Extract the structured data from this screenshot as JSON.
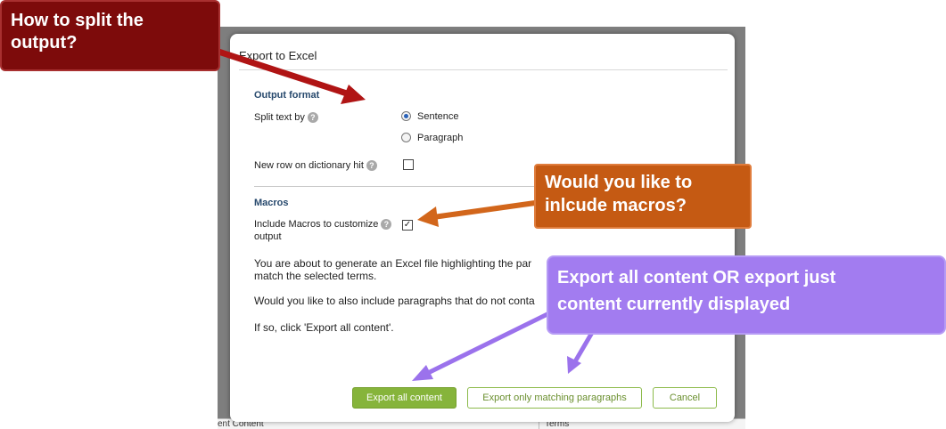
{
  "background": {
    "col1_text": "ent Content",
    "col2_text": "Terms"
  },
  "dialog": {
    "title": "Export to Excel",
    "output_format": {
      "heading": "Output format",
      "split_label": "Split text by",
      "options": [
        {
          "label": "Sentence",
          "selected": true
        },
        {
          "label": "Paragraph",
          "selected": false
        }
      ],
      "new_row_label": "New row on dictionary hit",
      "new_row_checked": false
    },
    "macros": {
      "heading": "Macros",
      "include_label_line1": "Include Macros to customize",
      "include_label_line2": "output",
      "include_checked": true
    },
    "message": {
      "line1": "You are about to generate an Excel file highlighting the par",
      "line2": "match the selected terms.",
      "line3": "Would you like to also include paragraphs that do not conta",
      "line4": "If so, click 'Export all content'."
    },
    "buttons": {
      "export_all": "Export all content",
      "export_matching": "Export only matching paragraphs",
      "cancel": "Cancel"
    }
  },
  "callouts": {
    "split": {
      "line1": "How to split the",
      "line2": "output?",
      "color": "#7d0b0b"
    },
    "macros": {
      "line1": "Would you like to",
      "line2": "inlcude macros?",
      "color": "#c55a13"
    },
    "export": {
      "line1": "Export all content OR export just",
      "line2": "content currently displayed",
      "color": "#a27cf0"
    }
  },
  "icons": {
    "help": "question-help-icon",
    "check": "checkmark-icon"
  },
  "colors": {
    "accent_green": "#86b43b",
    "section_heading": "#27496d"
  }
}
